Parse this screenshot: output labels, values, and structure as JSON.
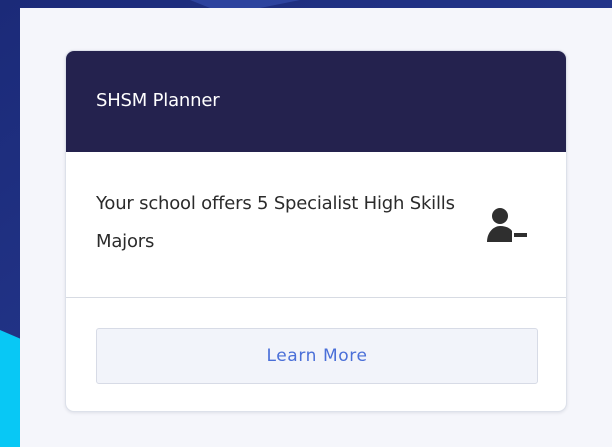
{
  "card": {
    "title": "SHSM Planner",
    "description": "Your school offers 5 Specialist High Skills Majors",
    "icon": "user-minus-icon",
    "button_label": "Learn More"
  },
  "colors": {
    "background": "#1f2f7a",
    "accent_shape": "#08c8f5",
    "panel": "#f5f6fb",
    "header": "#24224e",
    "button_text": "#4a6fd8"
  }
}
